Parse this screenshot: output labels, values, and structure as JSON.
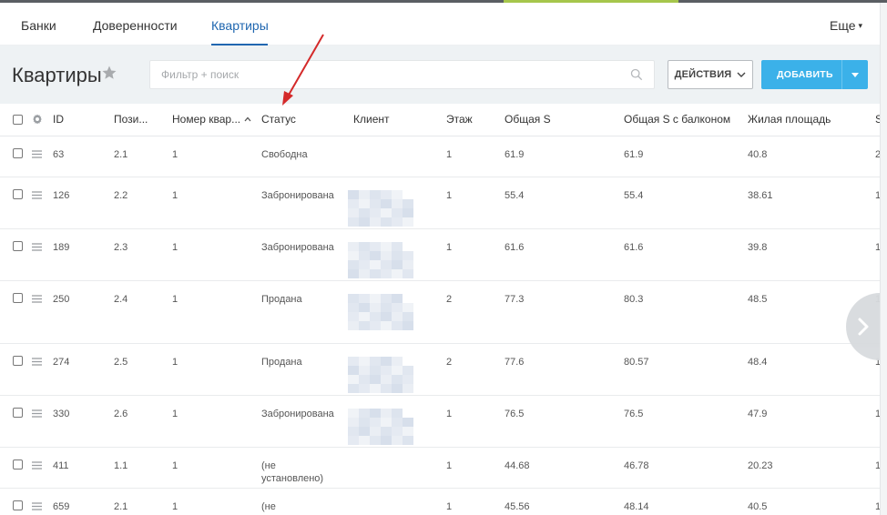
{
  "nav": {
    "tabs": [
      {
        "label": "Банки"
      },
      {
        "label": "Доверенности"
      },
      {
        "label": "Квартиры",
        "active": true
      }
    ],
    "more_label": "Еще"
  },
  "toolbar": {
    "title": "Квартиры",
    "search_placeholder": "Фильтр + поиск",
    "actions_label": "ДЕЙСТВИЯ",
    "add_label": "ДОБАВИТЬ"
  },
  "table": {
    "columns": {
      "id": "ID",
      "position": "Пози...",
      "apt_number": "Номер квар...",
      "status": "Статус",
      "client": "Клиент",
      "floor": "Этаж",
      "total_area": "Общая S",
      "area_balcony": "Общая S с балконом",
      "living_area": "Жилая площадь",
      "extra": "S"
    },
    "rows": [
      {
        "id": "63",
        "position": "2.1",
        "apt": "1",
        "status": "Свободна",
        "floor": "1",
        "total": "61.9",
        "balcony": "61.9",
        "living": "40.8",
        "extra": "2"
      },
      {
        "id": "126",
        "position": "2.2",
        "apt": "1",
        "status": "Забронирована",
        "floor": "1",
        "total": "55.4",
        "balcony": "55.4",
        "living": "38.61",
        "extra": "1"
      },
      {
        "id": "189",
        "position": "2.3",
        "apt": "1",
        "status": "Забронирована",
        "floor": "1",
        "total": "61.6",
        "balcony": "61.6",
        "living": "39.8",
        "extra": "1"
      },
      {
        "id": "250",
        "position": "2.4",
        "apt": "1",
        "status": "Продана",
        "floor": "2",
        "total": "77.3",
        "balcony": "80.3",
        "living": "48.5",
        "extra": "1"
      },
      {
        "id": "274",
        "position": "2.5",
        "apt": "1",
        "status": "Продана",
        "floor": "2",
        "total": "77.6",
        "balcony": "80.57",
        "living": "48.4",
        "extra": "1"
      },
      {
        "id": "330",
        "position": "2.6",
        "apt": "1",
        "status": "Забронирована",
        "floor": "1",
        "total": "76.5",
        "balcony": "76.5",
        "living": "47.9",
        "extra": "1"
      },
      {
        "id": "411",
        "position": "1.1",
        "apt": "1",
        "status": "(не\nустановлено)",
        "floor": "1",
        "total": "44.68",
        "balcony": "46.78",
        "living": "20.23",
        "extra": "1"
      },
      {
        "id": "659",
        "position": "2.1",
        "apt": "1",
        "status": "(не\nустановлено)",
        "floor": "1",
        "total": "45.56",
        "balcony": "48.14",
        "living": "40.5",
        "extra": "1"
      }
    ]
  },
  "colors": {
    "accent_blue": "#2067b0",
    "add_button": "#3bb1e9",
    "annotation_arrow": "#d42a2a",
    "toolbar_bg": "#eef2f4"
  },
  "icons": {
    "title_star": "star-icon",
    "search": "search-icon",
    "settings": "gear-icon",
    "row_handle": "menu-icon",
    "sort": "sort-ascending-icon",
    "next": "chevron-right-icon"
  }
}
